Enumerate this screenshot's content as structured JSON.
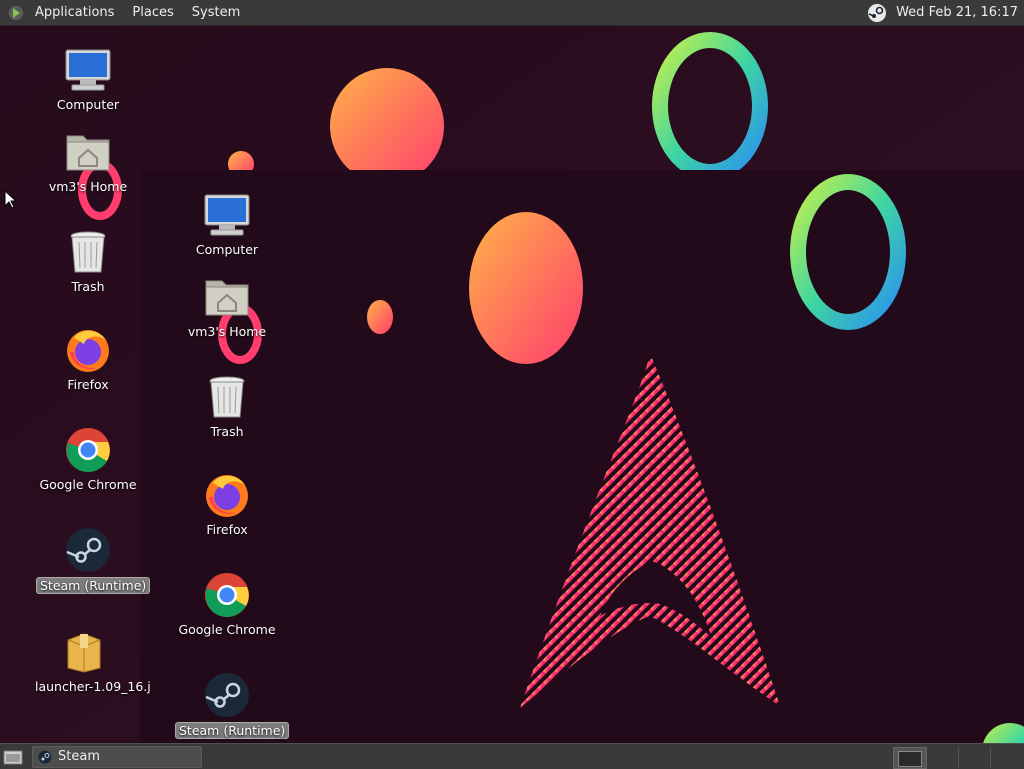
{
  "top_panel": {
    "menus": [
      "Applications",
      "Places",
      "System"
    ],
    "clock": "Wed Feb 21, 16:17"
  },
  "desktop_icons_col1": [
    {
      "label": "Computer",
      "icon": "computer-icon"
    },
    {
      "label": "vm3's Home",
      "icon": "home-folder-icon"
    },
    {
      "label": "Trash",
      "icon": "trash-icon"
    },
    {
      "label": "Firefox",
      "icon": "firefox-icon"
    },
    {
      "label": "Google Chrome",
      "icon": "chrome-icon"
    },
    {
      "label": "Steam (Runtime)",
      "icon": "steam-icon",
      "selected": true
    },
    {
      "label": "launcher-1.09_16.j",
      "icon": "package-icon"
    }
  ],
  "desktop_icons_col2": [
    {
      "label": "Computer",
      "icon": "computer-icon"
    },
    {
      "label": "vm3's Home",
      "icon": "home-folder-icon"
    },
    {
      "label": "Trash",
      "icon": "trash-icon"
    },
    {
      "label": "Firefox",
      "icon": "firefox-icon"
    },
    {
      "label": "Google Chrome",
      "icon": "chrome-icon"
    },
    {
      "label": "Steam (Runtime)",
      "icon": "steam-icon",
      "selected": true
    }
  ],
  "bottom_panel": {
    "task_label": "Steam"
  },
  "colors": {
    "panel": "#3a3a3a",
    "wallpaper": "#2a0f20"
  }
}
